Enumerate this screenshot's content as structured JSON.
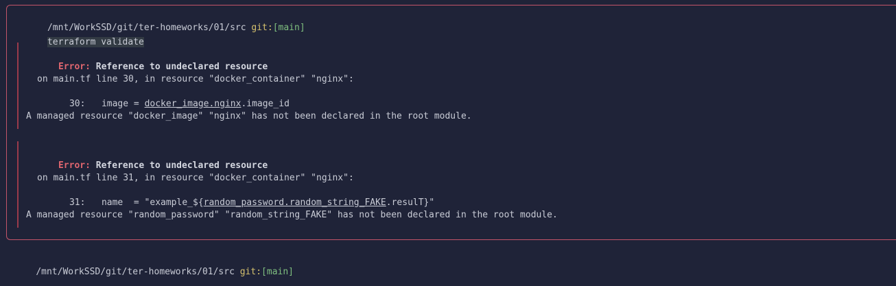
{
  "prompt": {
    "path": "/mnt/WorkSSD/git/ter-homeworks/01/src",
    "git_label": "git:",
    "branch": "[main]"
  },
  "command": "terraform validate",
  "errors": [
    {
      "label": "Error:",
      "title": "Reference to undeclared resource",
      "location": "on main.tf line 30, in resource \"docker_container\" \"nginx\":",
      "code_lineno": "30:",
      "code_pre": "image = ",
      "code_ref": "docker_image.nginx",
      "code_post": ".image_id",
      "message": "A managed resource \"docker_image\" \"nginx\" has not been declared in the root module."
    },
    {
      "label": "Error:",
      "title": "Reference to undeclared resource",
      "location": "on main.tf line 31, in resource \"docker_container\" \"nginx\":",
      "code_lineno": "31:",
      "code_pre": "name  = \"example_${",
      "code_ref": "random_password.random_string_FAKE",
      "code_post": ".resulT}\"",
      "message": "A managed resource \"random_password\" \"random_string_FAKE\" has not been declared in the root module."
    }
  ],
  "next_prompt": {
    "path": "/mnt/WorkSSD/git/ter-homeworks/01/src",
    "git_label": "git:",
    "branch": "[main]"
  },
  "colors": {
    "background": "#1f2338",
    "error_border": "#c4556a",
    "error_label": "#e0666f",
    "git_label": "#d6c26e",
    "branch": "#7fbf7f"
  }
}
